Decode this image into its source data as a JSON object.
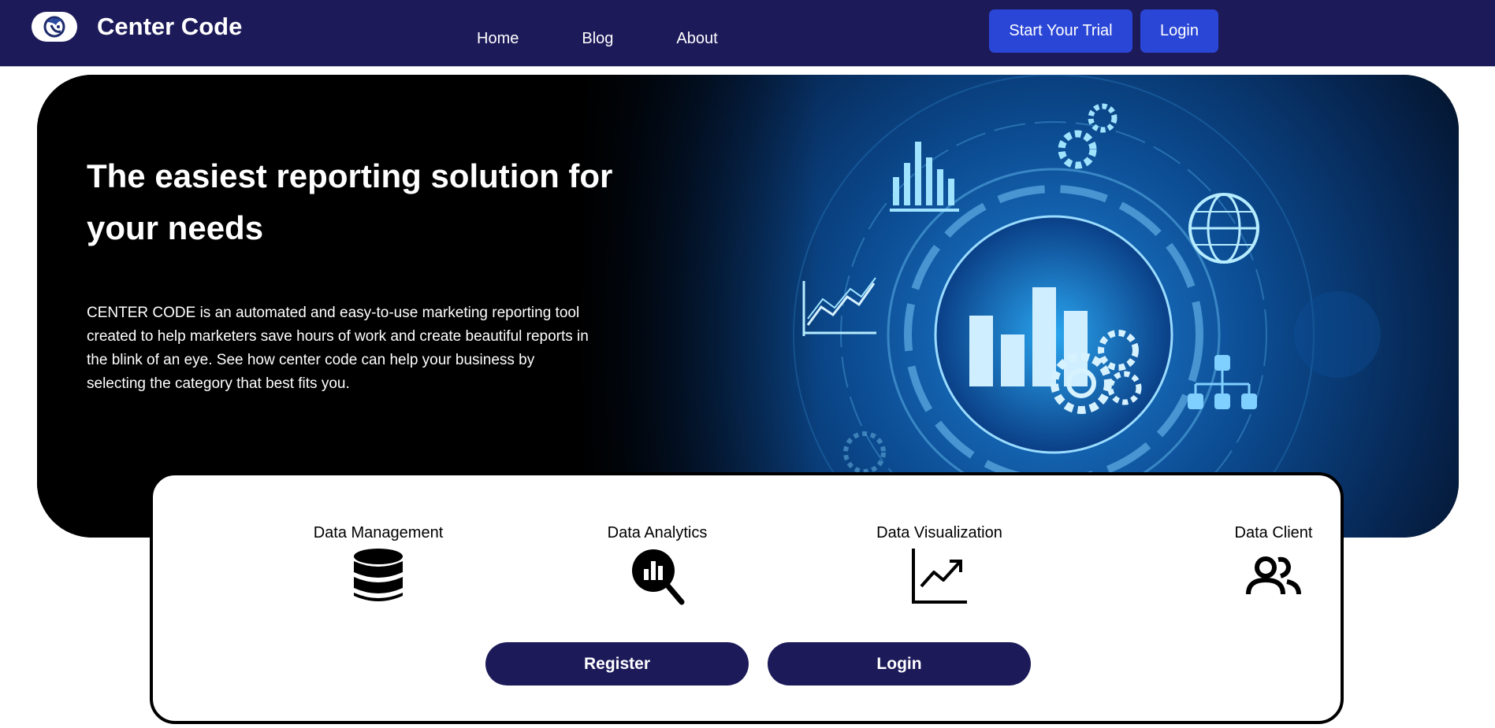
{
  "header": {
    "brand_name": "Center Code",
    "nav": {
      "home": "Home",
      "blog": "Blog",
      "about": "About"
    },
    "actions": {
      "trial": "Start Your Trial",
      "login": "Login"
    }
  },
  "hero": {
    "title": "The easiest reporting solution for your needs",
    "description": "CENTER CODE is an automated and easy-to-use marketing reporting tool created to help marketers save hours of work and create beautiful reports in the blink of an eye. See how center code can help your business by selecting the category that best fits you."
  },
  "categories": [
    {
      "label": "Data Management",
      "icon": "database-icon"
    },
    {
      "label": "Data Analytics",
      "icon": "analytics-search-icon"
    },
    {
      "label": "Data Visualization",
      "icon": "trend-chart-icon"
    },
    {
      "label": "Data Client",
      "icon": "users-icon"
    }
  ],
  "card_actions": {
    "register": "Register",
    "login": "Login"
  },
  "colors": {
    "navbar": "#1d1a5a",
    "nav_button": "#2a46d6",
    "card_button": "#1d1a5a",
    "hero_glow": "#1e7fd6"
  }
}
